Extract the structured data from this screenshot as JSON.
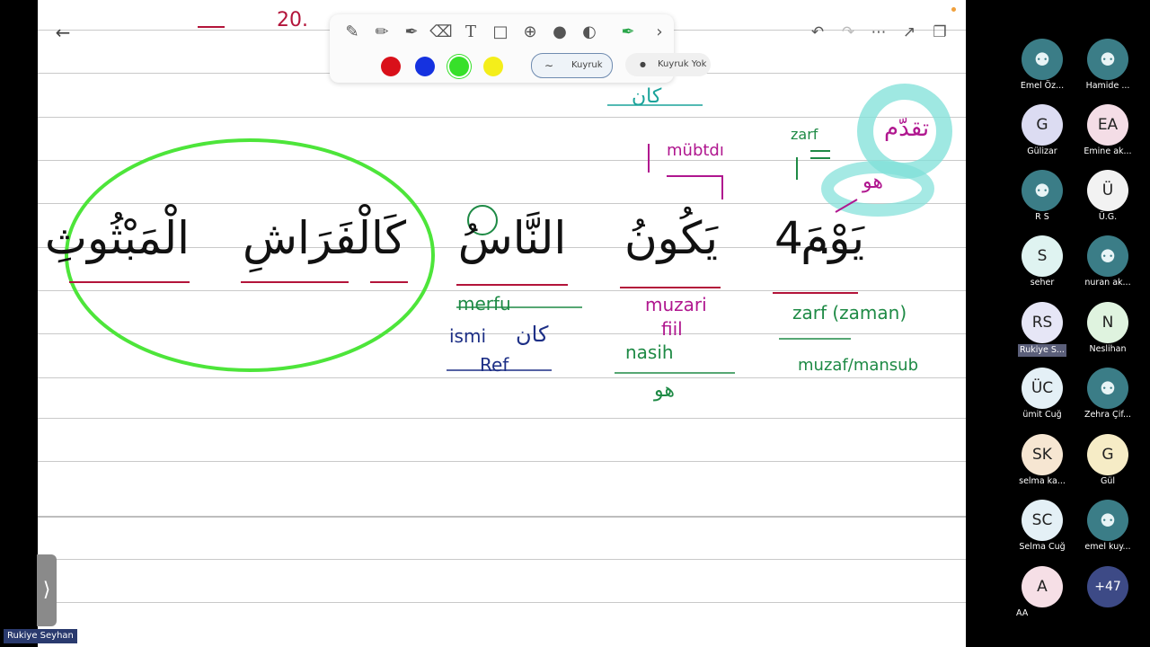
{
  "canvas_text": {
    "top_partial": "20.",
    "kana_note": "كان",
    "mubtada": "mübtdı",
    "zarf_small": "zarf",
    "tuqaddim": "تقدّم",
    "huwa_teal": "هو",
    "number": "4 .",
    "word_yawma": "يَوْمَ",
    "word_yakunu": "يَكُونُ",
    "word_nasu": "النَّاسُ",
    "word_kal_farash": "كَالْفَرَاشِ",
    "word_mabthuth": "الْمَبْثُوثِ",
    "merfu": "merfu",
    "ismi": "ismi",
    "kana_arabic": "كان",
    "ref": "Ref",
    "muzari": "muzari",
    "fiil": "fiil",
    "nasih": "nasih",
    "huwa_green": "هو",
    "zarf_zaman": "zarf (zaman)",
    "muzaf_mansub": "muzaf/mansub"
  },
  "toolbar": {
    "tools": [
      "pen-icon",
      "pencil-icon",
      "highlighter-icon",
      "eraser-icon",
      "text-icon",
      "lasso-icon",
      "add-icon",
      "mic-icon",
      "shape-icon",
      "laser-pointer-icon",
      "chevron-right-icon"
    ],
    "colors": [
      "#d9101a",
      "#1532e0",
      "#37e02a",
      "#f4ee1a"
    ],
    "tail_on": "Kuyruk",
    "tail_off": "Kuyruk Yok"
  },
  "participants": [
    {
      "name": "Emel Öz...",
      "initials": "",
      "avatar_bg": "#3b7d87"
    },
    {
      "name": "Hamide ...",
      "initials": "",
      "avatar_bg": "#3b7d87"
    },
    {
      "name": "Gülizar",
      "initials": "G",
      "avatar_bg": "#dcdcf2"
    },
    {
      "name": "Emine ak...",
      "initials": "EA",
      "avatar_bg": "#f4dde6"
    },
    {
      "name": "R S",
      "initials": "",
      "avatar_bg": "#3b7d87"
    },
    {
      "name": "Ü.G.",
      "initials": "Ü",
      "avatar_bg": "#f2f2f2"
    },
    {
      "name": "seher",
      "initials": "S",
      "avatar_bg": "#dff3f1"
    },
    {
      "name": "nuran ak...",
      "initials": "",
      "avatar_bg": "#3b7d87"
    },
    {
      "name": "Rukiye S...",
      "initials": "RS",
      "avatar_bg": "#e6e6f6"
    },
    {
      "name": "Neslihan",
      "initials": "N",
      "avatar_bg": "#dff3df"
    },
    {
      "name": "ümit Cuğ",
      "initials": "ÜC",
      "avatar_bg": "#e4f0f6"
    },
    {
      "name": "Zehra Çif...",
      "initials": "",
      "avatar_bg": "#3b7d87"
    },
    {
      "name": "selma ka...",
      "initials": "SK",
      "avatar_bg": "#f6e6d2"
    },
    {
      "name": "Gül",
      "initials": "G",
      "avatar_bg": "#f6ecc6"
    },
    {
      "name": "Selma Cuğ",
      "initials": "SC",
      "avatar_bg": "#e4f0f6"
    },
    {
      "name": "emel kuy...",
      "initials": "",
      "avatar_bg": "#3b7d87"
    },
    {
      "name": "AA",
      "initials": "A",
      "avatar_bg": "#f6dfe6"
    },
    {
      "name": "",
      "initials": "+47",
      "avatar_bg": "#3d4a86"
    }
  ],
  "speaker_label": "Rukiye Seyhan",
  "colors": {
    "lasso_green": "#4de53a",
    "teal_highlight": "#7fe0d8"
  }
}
